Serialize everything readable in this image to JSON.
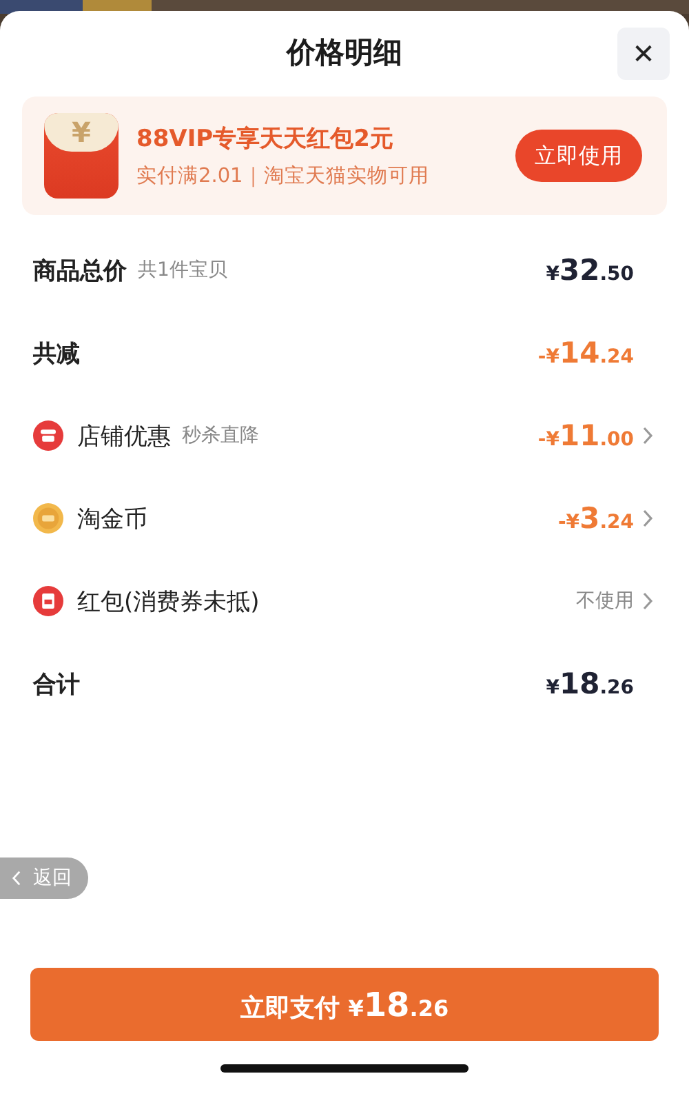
{
  "sheet": {
    "title": "价格明细",
    "close": "✕"
  },
  "promo": {
    "title": "88VIP专享天天红包2元",
    "subtitle": "实付满2.01｜淘宝天猫实物可用",
    "button": "立即使用",
    "badge": "¥"
  },
  "rows": [
    {
      "kind": "heading",
      "label": "商品总价",
      "note": "共1件宝贝",
      "price": {
        "prefix": "¥",
        "whole": "32",
        "fraction": ".50"
      },
      "negative": false,
      "chevron": false
    },
    {
      "kind": "heading",
      "label": "共减",
      "price": {
        "prefix": "-¥",
        "whole": "14",
        "fraction": ".24"
      },
      "negative": true,
      "chevron": false
    },
    {
      "kind": "item",
      "label": "店铺优惠",
      "note": "秒杀直降",
      "price": {
        "prefix": "-¥",
        "whole": "11",
        "fraction": ".00"
      },
      "negative": true,
      "chevron": true
    },
    {
      "kind": "item",
      "label": "淘金币",
      "price": {
        "prefix": "-¥",
        "whole": "3",
        "fraction": ".24"
      },
      "negative": true,
      "chevron": true
    },
    {
      "kind": "item",
      "label": "红包(消费券未抵)",
      "value": "不使用",
      "negative": false,
      "chevron": true
    },
    {
      "kind": "heading",
      "label": "合计",
      "price": {
        "prefix": "¥",
        "whole": "18",
        "fraction": ".26"
      },
      "negative": false,
      "chevron": false
    }
  ],
  "back_button": {
    "label": "返回"
  },
  "pay_button": {
    "label": "立即支付",
    "price": {
      "prefix": "¥",
      "whole": "18",
      "fraction": ".26"
    }
  }
}
